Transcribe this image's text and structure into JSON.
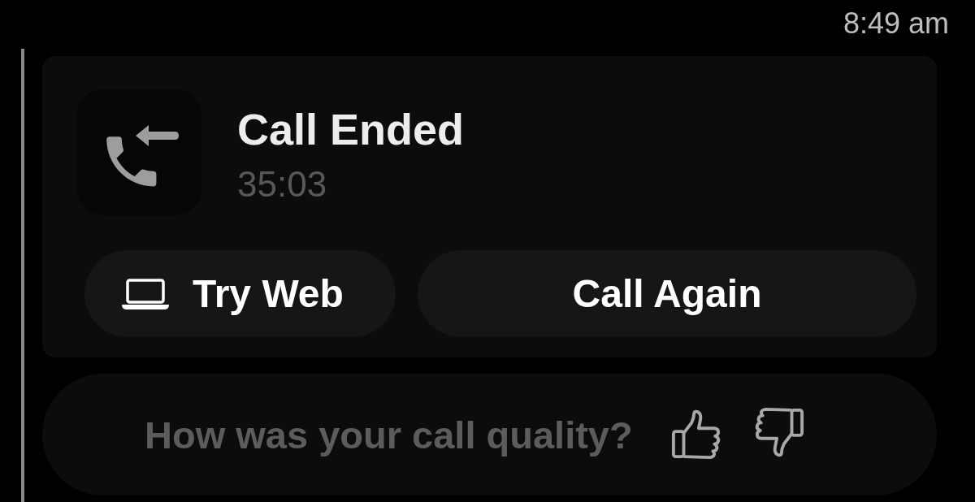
{
  "status_bar": {
    "time": "8:49 am"
  },
  "call_card": {
    "title": "Call Ended",
    "duration": "35:03",
    "buttons": [
      {
        "label": "Try Web",
        "kind": "icon"
      },
      {
        "label": "Call Again",
        "kind": "plain"
      }
    ]
  },
  "feedback": {
    "prompt": "How was your call quality?"
  }
}
